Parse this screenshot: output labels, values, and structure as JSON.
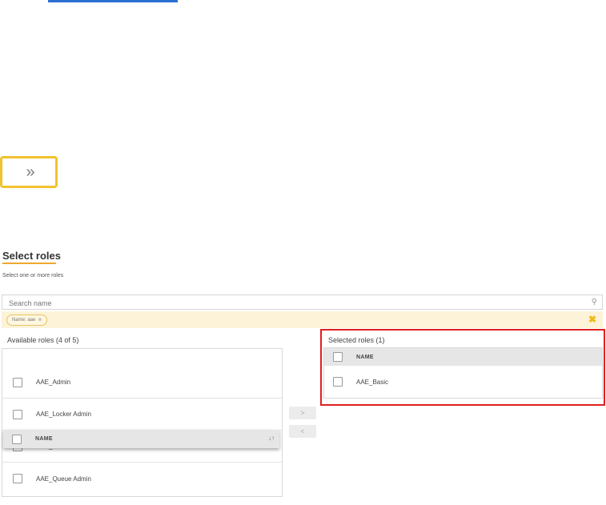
{
  "expand_button": {
    "label": "»"
  },
  "section": {
    "title": "Select roles",
    "subtitle": "Select one or more roles"
  },
  "search": {
    "placeholder": "Search name",
    "icon": "search-icon"
  },
  "filter": {
    "chip_label": "Name: aae",
    "chip_close": "⊗",
    "clear_label": "✖"
  },
  "available": {
    "title": "Available roles (4 of 5)",
    "items": [
      {
        "label": "AAE_Admin"
      },
      {
        "label": "AAE_Locker Admin"
      },
      {
        "label": "AAE_Pool Admin"
      },
      {
        "label": "AAE_Queue Admin"
      }
    ],
    "drag_header": {
      "column": "NAME",
      "sort_icon": "↓↑"
    }
  },
  "transfer": {
    "add_label": ">",
    "remove_label": "<"
  },
  "selected": {
    "title": "Selected roles (1)",
    "column": "NAME",
    "items": [
      {
        "label": "AAE_Basic"
      }
    ]
  },
  "colors": {
    "accent": "#f2c12e",
    "highlight_frame": "#e02020",
    "link": "#2a6fd1"
  }
}
